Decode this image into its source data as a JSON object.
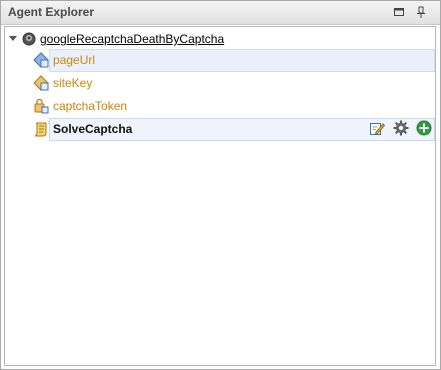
{
  "panel": {
    "title": "Agent Explorer",
    "restore_icon": "restore-window-icon",
    "pin_icon": "pin-icon"
  },
  "tree": {
    "root": {
      "label": "googleRecaptchaDeathByCaptcha",
      "icon": "agent-icon"
    },
    "items": [
      {
        "label": "pageUrl",
        "icon": "variable-input-icon",
        "selected": true
      },
      {
        "label": "siteKey",
        "icon": "variable-input-icon"
      },
      {
        "label": "captchaToken",
        "icon": "variable-output-icon"
      },
      {
        "label": "SolveCaptcha",
        "icon": "script-icon",
        "hovered": true,
        "actions": [
          "edit-icon",
          "gear-icon",
          "add-icon"
        ]
      }
    ]
  },
  "colors": {
    "variable_text": "#c8860a",
    "selection_bg": "#eaf0fb",
    "add_green": "#2f9e44"
  }
}
